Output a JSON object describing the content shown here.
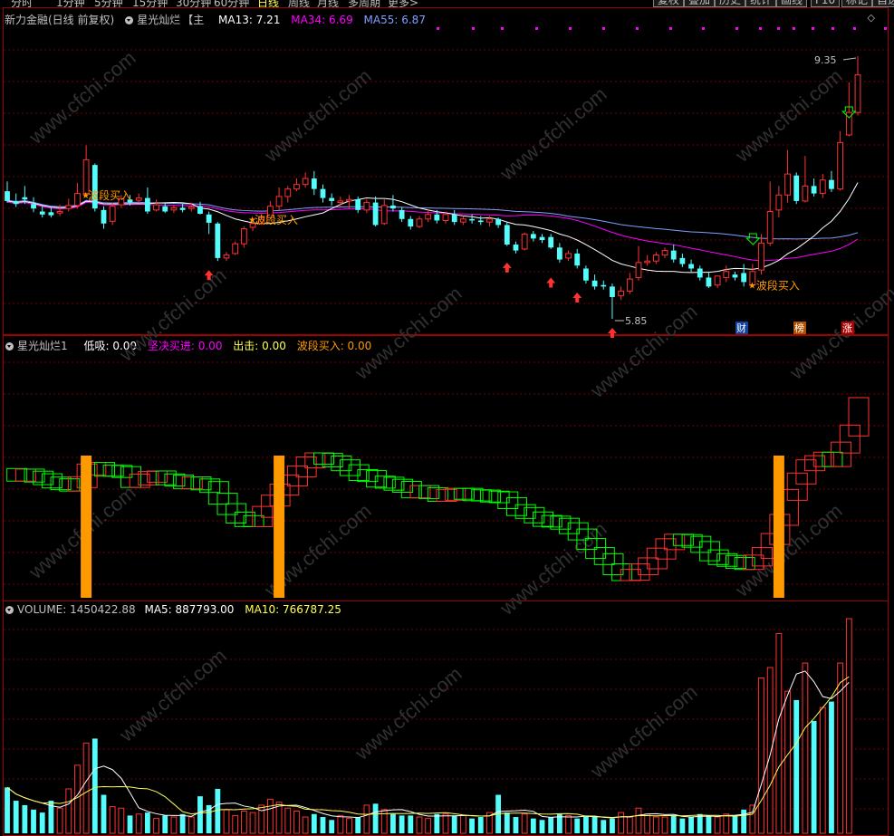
{
  "toolbar": {
    "periods": [
      "分时",
      "1分钟",
      "5分钟",
      "15分钟",
      "30分钟",
      "60分钟",
      "日线",
      "周线",
      "月线",
      "多周期",
      "更多>"
    ],
    "active_period": "日线",
    "buttons": [
      "复权",
      "叠加",
      "历史",
      "统计",
      "画线",
      "F10",
      "标记",
      "自选"
    ]
  },
  "main_panel": {
    "stock_title": "新力金融(日线 前复权)",
    "indicator_name": "星光灿烂",
    "indicator_suffix": "【主",
    "ma13_label": "MA13: 7.21",
    "ma34_label": "MA34: 6.69",
    "ma55_label": "MA55: 6.87",
    "high_label": "9.35",
    "low_label": "5.85",
    "signal_text": "波段买入",
    "badge_cai": "财",
    "badge_bang": "榜",
    "badge_zhang": "涨",
    "corner_icon": "◇"
  },
  "indicator_panel": {
    "name": "星光灿烂1",
    "low_buy": "低吸: 0.00",
    "firm_buy": "坚决买进: 0.00",
    "attack": "出击: 0.00",
    "wave_buy": "波段买入: 0.00"
  },
  "volume_panel": {
    "volume_label": "VOLUME: 1450422.88",
    "ma5_label": "MA5: 887793.00",
    "ma10_label": "MA10: 766787.25"
  },
  "colors": {
    "up": "#ff3232",
    "down": "#54fcfc",
    "ma13": "#ffffff",
    "ma34": "#ff00ff",
    "ma55": "#7f9fff",
    "signal": "#ff9900",
    "grid": "#700000"
  },
  "watermark": "www.cfchi.com",
  "chart_data": {
    "type": "candlestick",
    "price_range": [
      5.85,
      9.35
    ],
    "candles": [
      [
        7.55,
        7.68,
        7.42,
        7.4
      ],
      [
        7.42,
        7.52,
        7.38,
        7.34
      ],
      [
        7.47,
        7.62,
        7.44,
        7.38
      ],
      [
        7.38,
        7.47,
        7.32,
        7.27
      ],
      [
        7.28,
        7.35,
        7.24,
        7.2
      ],
      [
        7.27,
        7.34,
        7.23,
        7.2
      ],
      [
        7.26,
        7.37,
        7.28,
        7.22
      ],
      [
        7.32,
        7.45,
        7.36,
        7.28
      ],
      [
        7.36,
        7.66,
        7.52,
        7.32
      ],
      [
        7.52,
        8.16,
        7.97,
        7.48
      ],
      [
        7.9,
        7.92,
        7.32,
        7.28
      ],
      [
        7.3,
        7.35,
        7.12,
        7.05
      ],
      [
        7.15,
        7.4,
        7.35,
        7.1
      ],
      [
        7.37,
        7.5,
        7.45,
        7.33
      ],
      [
        7.44,
        7.5,
        7.4,
        7.36
      ],
      [
        7.43,
        7.52,
        7.46,
        7.4
      ],
      [
        7.46,
        7.6,
        7.28,
        7.25
      ],
      [
        7.3,
        7.44,
        7.37,
        7.28
      ],
      [
        7.35,
        7.39,
        7.28,
        7.26
      ],
      [
        7.3,
        7.37,
        7.33,
        7.26
      ],
      [
        7.33,
        7.38,
        7.3,
        7.27
      ],
      [
        7.32,
        7.4,
        7.34,
        7.28
      ],
      [
        7.35,
        7.41,
        7.25,
        7.24
      ],
      [
        7.24,
        7.28,
        7.13,
        6.98
      ],
      [
        7.12,
        7.14,
        6.66,
        6.62
      ],
      [
        6.66,
        6.74,
        6.7,
        6.62
      ],
      [
        6.72,
        6.88,
        6.85,
        6.7
      ],
      [
        6.85,
        7.08,
        7.05,
        6.8
      ],
      [
        7.07,
        7.16,
        7.12,
        7.02
      ],
      [
        7.12,
        7.24,
        7.2,
        7.1
      ],
      [
        7.2,
        7.42,
        7.35,
        7.18
      ],
      [
        7.35,
        7.6,
        7.48,
        7.3
      ],
      [
        7.48,
        7.62,
        7.58,
        7.4
      ],
      [
        7.58,
        7.72,
        7.64,
        7.55
      ],
      [
        7.64,
        7.8,
        7.72,
        7.6
      ],
      [
        7.72,
        7.82,
        7.58,
        7.5
      ],
      [
        7.58,
        7.64,
        7.46,
        7.4
      ],
      [
        7.46,
        7.52,
        7.42,
        7.36
      ],
      [
        7.4,
        7.48,
        7.42,
        7.34
      ],
      [
        7.42,
        7.5,
        7.44,
        7.32
      ],
      [
        7.44,
        7.48,
        7.3,
        7.26
      ],
      [
        7.3,
        7.44,
        7.4,
        7.26
      ],
      [
        7.4,
        7.48,
        7.1,
        7.08
      ],
      [
        7.12,
        7.44,
        7.36,
        7.1
      ],
      [
        7.36,
        7.5,
        7.32,
        7.28
      ],
      [
        7.3,
        7.34,
        7.18,
        7.14
      ],
      [
        7.18,
        7.22,
        7.08,
        7.04
      ],
      [
        7.08,
        7.22,
        7.18,
        7.06
      ],
      [
        7.18,
        7.3,
        7.24,
        7.14
      ],
      [
        7.24,
        7.3,
        7.16,
        7.12
      ],
      [
        7.16,
        7.28,
        7.24,
        7.12
      ],
      [
        7.24,
        7.3,
        7.14,
        7.1
      ],
      [
        7.14,
        7.22,
        7.18,
        7.1
      ],
      [
        7.18,
        7.24,
        7.16,
        7.12
      ],
      [
        7.16,
        7.22,
        7.14,
        7.1
      ],
      [
        7.14,
        7.22,
        7.18,
        7.08
      ],
      [
        7.18,
        7.2,
        7.1,
        7.06
      ],
      [
        7.1,
        7.14,
        6.84,
        6.82
      ],
      [
        6.84,
        6.88,
        6.76,
        6.72
      ],
      [
        6.78,
        7.0,
        6.98,
        6.76
      ],
      [
        6.98,
        7.02,
        6.92,
        6.88
      ],
      [
        6.94,
        6.98,
        6.9,
        6.86
      ],
      [
        6.94,
        6.98,
        6.8,
        6.78
      ],
      [
        6.8,
        6.86,
        6.64,
        6.6
      ],
      [
        6.66,
        6.76,
        6.72,
        6.62
      ],
      [
        6.72,
        6.78,
        6.56,
        6.52
      ],
      [
        6.52,
        6.56,
        6.36,
        6.32
      ],
      [
        6.36,
        6.44,
        6.28,
        6.24
      ],
      [
        6.3,
        6.36,
        6.28,
        6.24
      ],
      [
        6.28,
        6.32,
        6.14,
        5.85
      ],
      [
        6.16,
        6.28,
        6.22,
        6.1
      ],
      [
        6.22,
        6.46,
        6.38,
        6.18
      ],
      [
        6.4,
        6.82,
        6.6,
        6.36
      ],
      [
        6.6,
        6.7,
        6.62,
        6.56
      ],
      [
        6.62,
        6.74,
        6.7,
        6.58
      ],
      [
        6.7,
        6.8,
        6.76,
        6.66
      ],
      [
        6.76,
        6.84,
        6.64,
        6.6
      ],
      [
        6.66,
        6.72,
        6.58,
        6.54
      ],
      [
        6.58,
        6.64,
        6.52,
        6.46
      ],
      [
        6.52,
        6.56,
        6.4,
        6.36
      ],
      [
        6.4,
        6.48,
        6.28,
        6.26
      ],
      [
        6.3,
        6.4,
        6.42,
        6.26
      ],
      [
        6.4,
        6.56,
        6.48,
        6.34
      ],
      [
        6.44,
        6.48,
        6.4,
        6.36
      ],
      [
        6.46,
        6.58,
        6.34,
        6.28
      ],
      [
        6.3,
        6.58,
        6.48,
        6.28
      ],
      [
        6.5,
        6.98,
        6.86,
        6.44
      ],
      [
        6.86,
        7.68,
        7.28,
        6.82
      ],
      [
        7.3,
        7.62,
        7.5,
        7.2
      ],
      [
        7.5,
        8.1,
        7.78,
        7.4
      ],
      [
        7.76,
        7.8,
        7.42,
        7.38
      ],
      [
        7.42,
        8.02,
        7.62,
        7.4
      ],
      [
        7.62,
        7.72,
        7.52,
        7.48
      ],
      [
        7.52,
        7.78,
        7.7,
        7.46
      ],
      [
        7.7,
        7.82,
        7.58,
        7.54
      ],
      [
        7.58,
        8.35,
        8.2,
        7.56
      ],
      [
        8.3,
        9.0,
        8.6,
        8.28
      ],
      [
        8.6,
        9.35,
        9.1,
        8.56
      ]
    ],
    "volume": [
      310000,
      220000,
      190000,
      160000,
      140000,
      220000,
      170000,
      300000,
      460000,
      610000,
      640000,
      260000,
      180000,
      170000,
      120000,
      130000,
      140000,
      100000,
      120000,
      110000,
      130000,
      110000,
      250000,
      190000,
      300000,
      160000,
      120000,
      150000,
      140000,
      190000,
      230000,
      210000,
      170000,
      150000,
      110000,
      130000,
      110000,
      90000,
      120000,
      100000,
      110000,
      190000,
      200000,
      160000,
      130000,
      120000,
      120000,
      110000,
      100000,
      130000,
      130000,
      120000,
      120000,
      100000,
      110000,
      140000,
      260000,
      140000,
      110000,
      130000,
      100000,
      90000,
      110000,
      130000,
      120000,
      100000,
      120000,
      110000,
      90000,
      100000,
      140000,
      110000,
      170000,
      130000,
      110000,
      110000,
      120000,
      100000,
      110000,
      130000,
      120000,
      110000,
      130000,
      120000,
      160000,
      190000,
      1050000,
      1120000,
      1350000,
      960000,
      900000,
      1150000,
      760000,
      850000,
      890000,
      1150000,
      1450000
    ]
  }
}
